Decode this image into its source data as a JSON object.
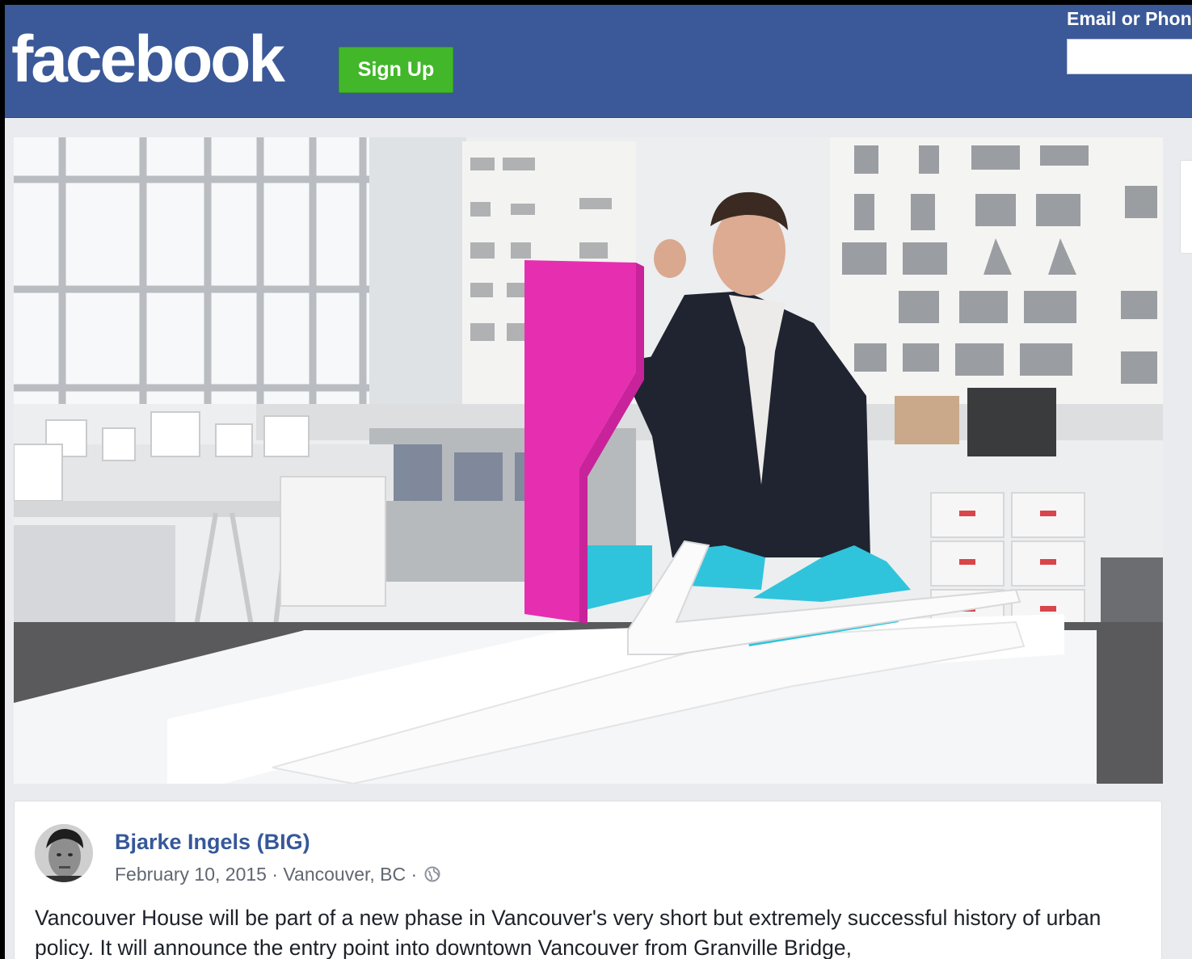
{
  "header": {
    "logo": "facebook",
    "signup_label": "Sign Up",
    "login_label": "Email or Phone",
    "login_value": ""
  },
  "video": {
    "icon": "video-frame"
  },
  "post": {
    "author": "Bjarke Ingels (BIG)",
    "date": "February 10, 2015",
    "separator": "·",
    "location": "Vancouver, BC",
    "privacy_icon": "globe-icon",
    "text": "Vancouver House will be part of a new phase in Vancouver's very short but extremely successful history of urban policy. It will announce the entry point into downtown Vancouver from Granville Bridge,"
  },
  "colors": {
    "header": "#3b5998",
    "signup": "#42b72a",
    "link": "#365899",
    "tower": "#e52fb0",
    "podium": "#2fc4dc"
  }
}
